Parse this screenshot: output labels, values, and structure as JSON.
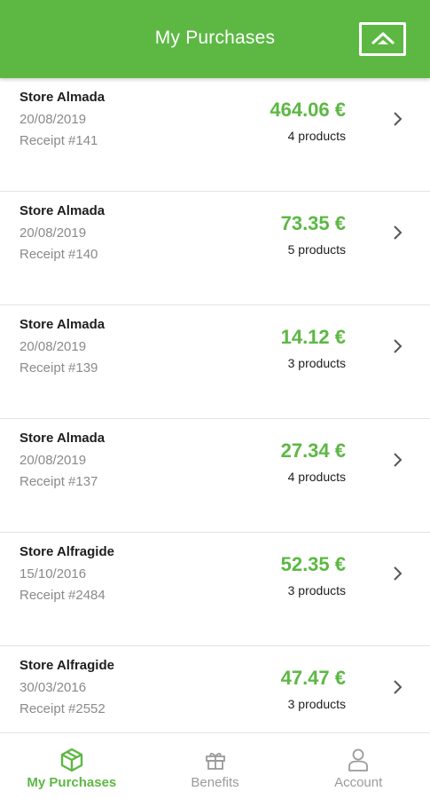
{
  "header": {
    "title": "My Purchases",
    "logo_icon": "house-up-arrow-icon"
  },
  "purchases": [
    {
      "store": "Store Almada",
      "date": "20/08/2019",
      "receipt": "Receipt #141",
      "total": "464.06 €",
      "products": "4 products"
    },
    {
      "store": "Store Almada",
      "date": "20/08/2019",
      "receipt": "Receipt #140",
      "total": "73.35 €",
      "products": "5 products"
    },
    {
      "store": "Store Almada",
      "date": "20/08/2019",
      "receipt": "Receipt #139",
      "total": "14.12 €",
      "products": "3 products"
    },
    {
      "store": "Store Almada",
      "date": "20/08/2019",
      "receipt": "Receipt #137",
      "total": "27.34 €",
      "products": "4 products"
    },
    {
      "store": "Store Alfragide",
      "date": "15/10/2016",
      "receipt": "Receipt #2484",
      "total": "52.35 €",
      "products": "3 products"
    },
    {
      "store": "Store Alfragide",
      "date": "30/03/2016",
      "receipt": "Receipt #2552",
      "total": "47.47 €",
      "products": "3 products"
    }
  ],
  "tabs": [
    {
      "label": "My Purchases",
      "icon": "box-icon",
      "active": true
    },
    {
      "label": "Benefits",
      "icon": "gift-icon",
      "active": false
    },
    {
      "label": "Account",
      "icon": "user-icon",
      "active": false
    }
  ],
  "colors": {
    "accent": "#5cb843",
    "muted": "#8a8a8a",
    "inactive_tab": "#9a9a9a"
  }
}
